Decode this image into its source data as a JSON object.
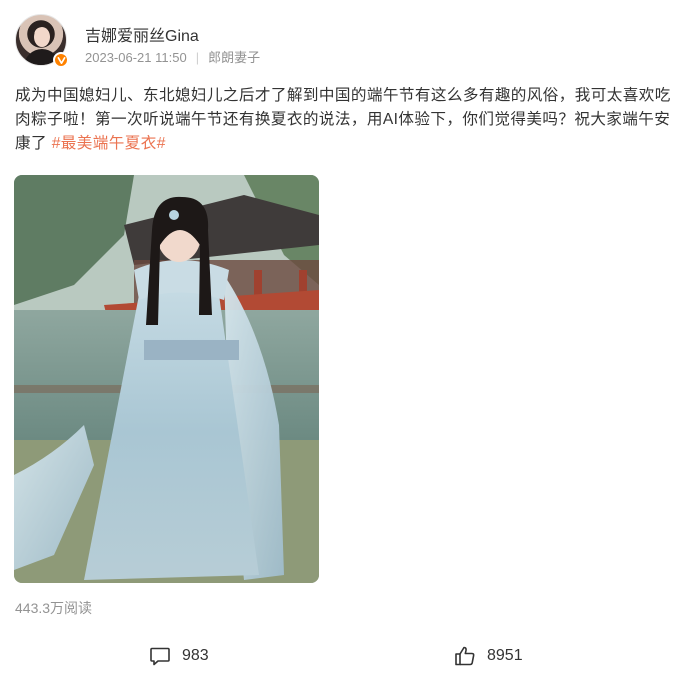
{
  "user": {
    "name": "吉娜爱丽丝Gina",
    "timestamp": "2023-06-21 11:50",
    "source": "郎朗妻子",
    "badge": "verified-orange"
  },
  "post": {
    "text_main": "成为中国媳妇儿、东北媳妇儿之后才了解到中国的端午节有这么多有趣的风俗，我可太喜欢吃肉粽子啦！第一次听说端午节还有换夏衣的说法，用AI体验下，你们觉得美吗？祝大家端午安康了 ",
    "hashtag": "#最美端午夏衣#"
  },
  "stats": {
    "reads": "443.3万阅读",
    "comments": "983",
    "likes": "8951"
  },
  "icons": {
    "comment": "comment-icon",
    "like": "thumbs-up-icon",
    "badge": "verified-v-icon"
  },
  "colors": {
    "hashtag": "#eb7350",
    "meta_gray": "#939393",
    "badge_orange": "#ff8200"
  }
}
